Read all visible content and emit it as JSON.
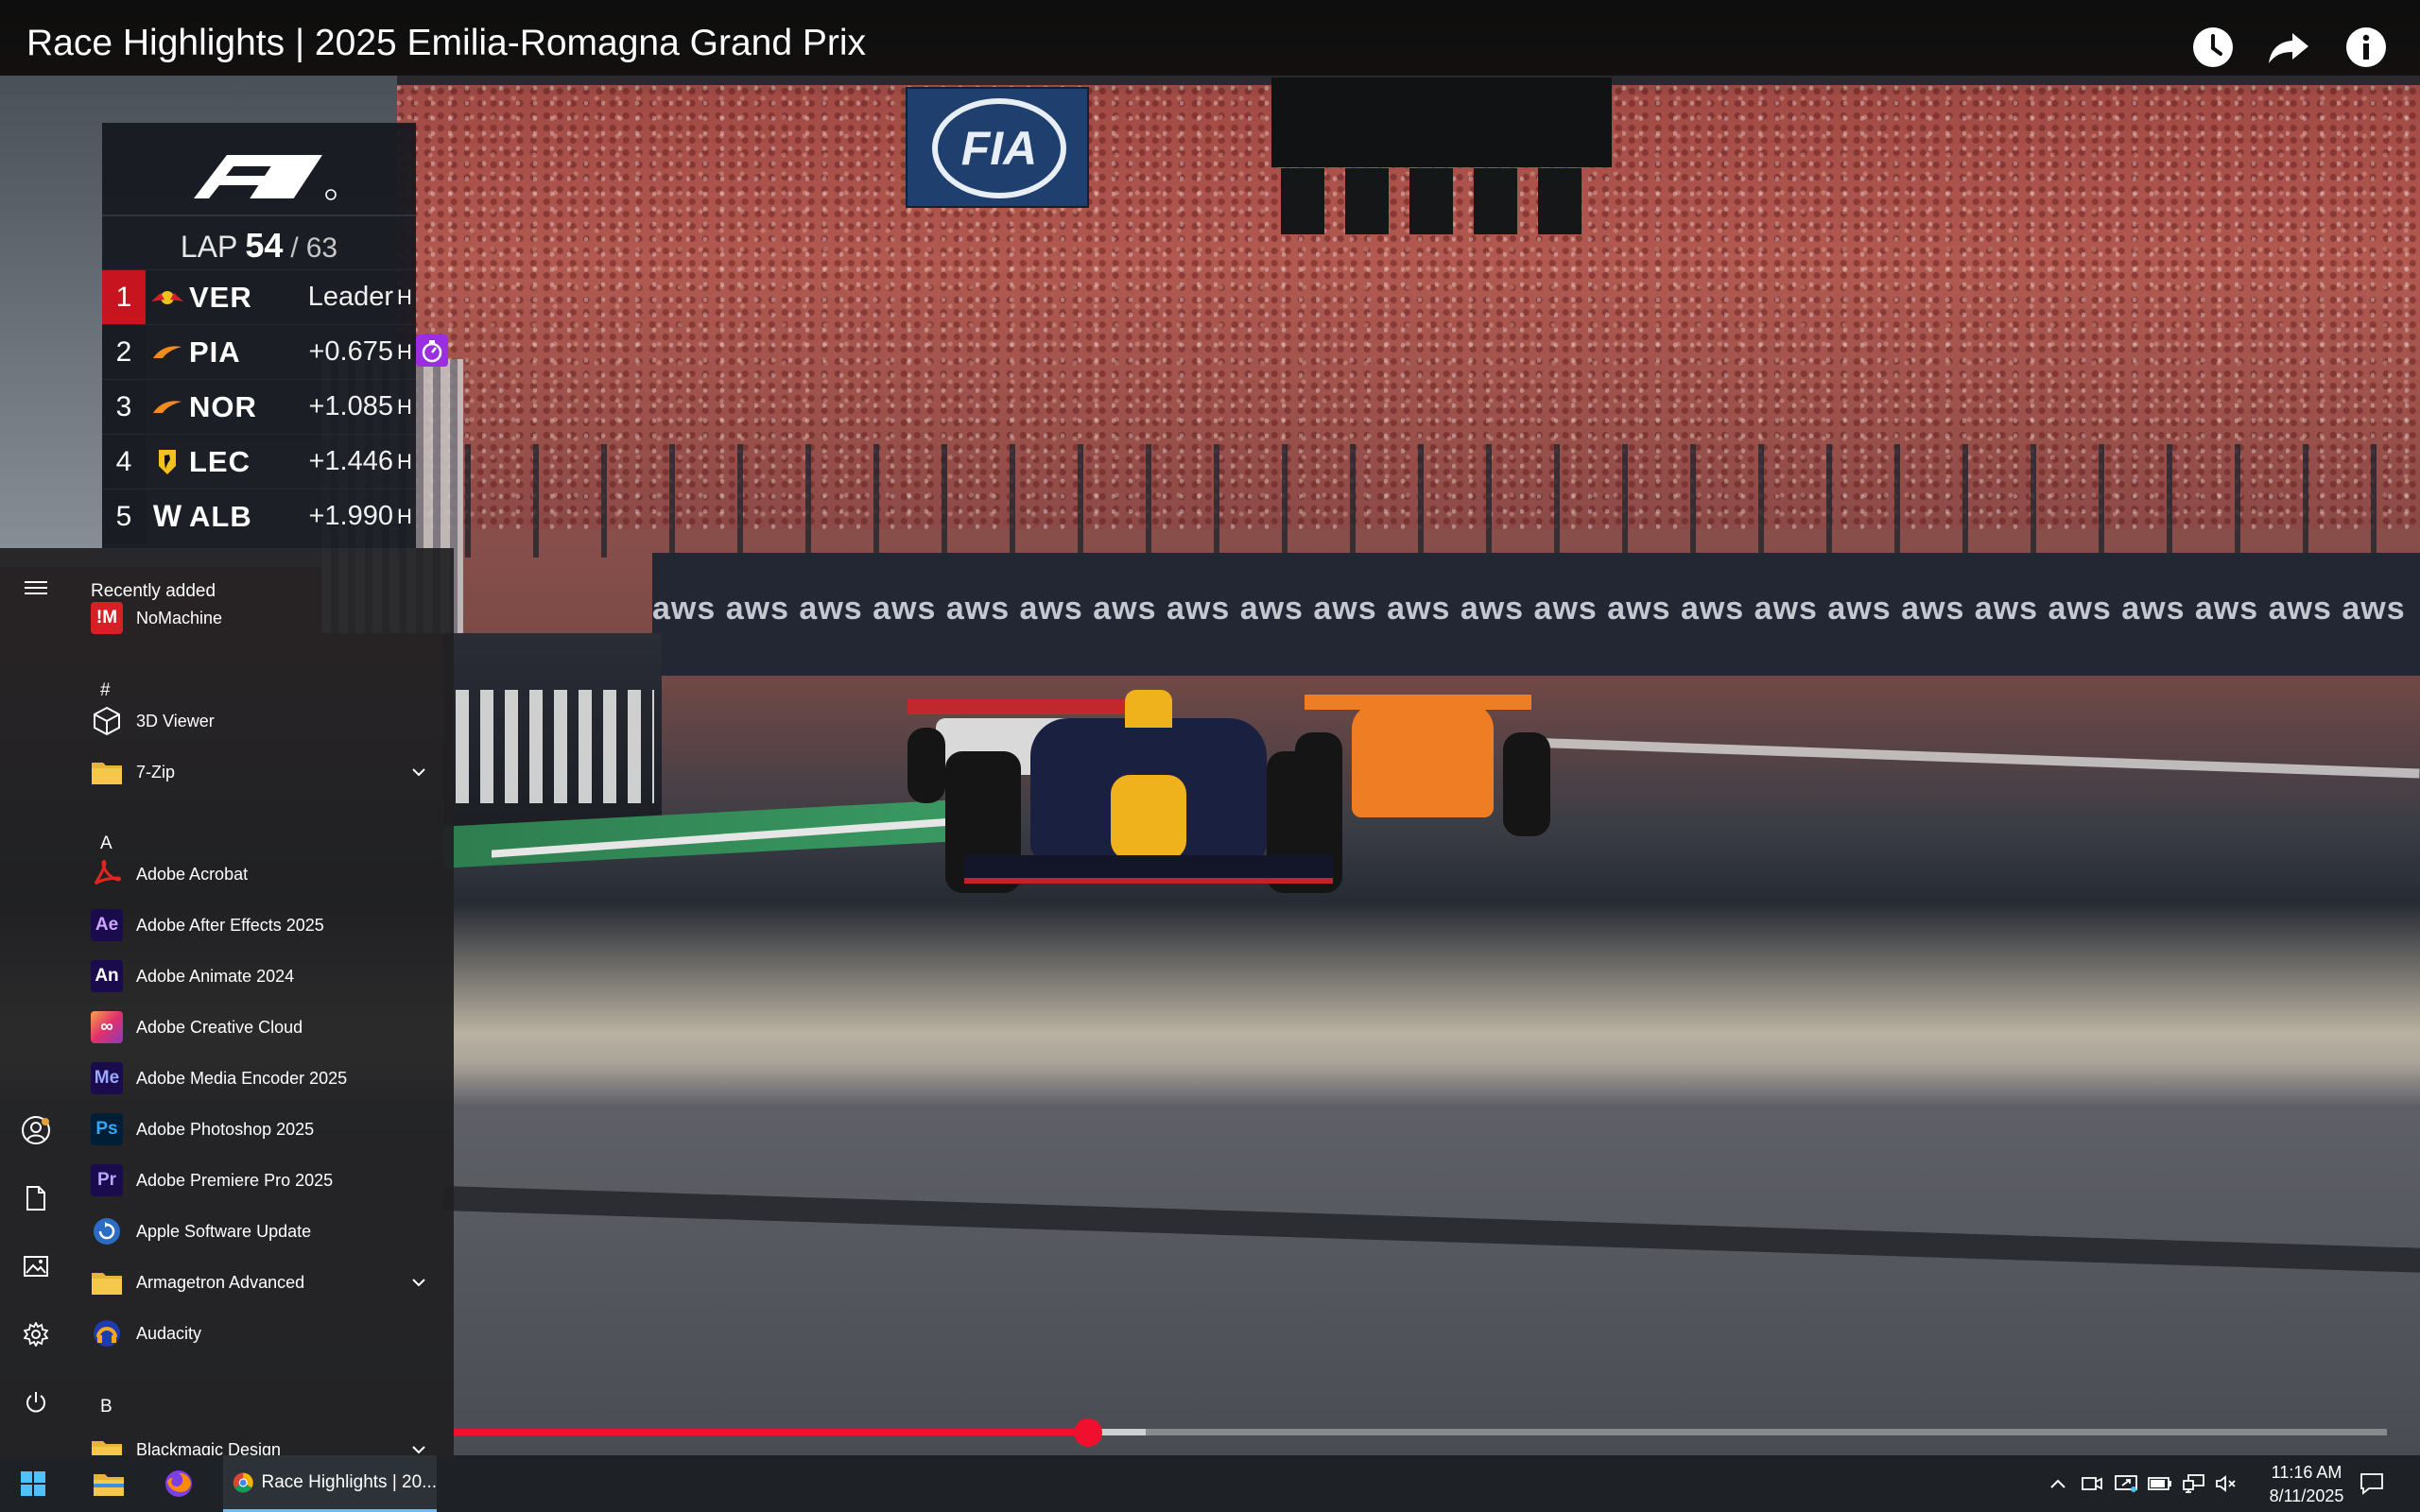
{
  "window": {
    "title": "Race Highlights | 2025 Emilia-Romagna Grand Prix"
  },
  "video_controls": {
    "clock_icon": "clock-icon",
    "share_icon": "share-arrow-icon",
    "info_icon": "info-icon",
    "progress_fraction": 0.328,
    "buffered_fraction": 0.358,
    "accent_color": "#f0102e"
  },
  "tower": {
    "lap_label": "LAP",
    "lap_current": "54",
    "lap_separator": "/",
    "lap_total": "63",
    "rows": [
      {
        "pos": "1",
        "team": "red-bull-icon",
        "code": "VER",
        "gap": "Leader",
        "tyre": "H"
      },
      {
        "pos": "2",
        "team": "mclaren-icon",
        "code": "PIA",
        "gap": "+0.675",
        "tyre": "H"
      },
      {
        "pos": "3",
        "team": "mclaren-icon",
        "code": "NOR",
        "gap": "+1.085",
        "tyre": "H"
      },
      {
        "pos": "4",
        "team": "ferrari-icon",
        "code": "LEC",
        "gap": "+1.446",
        "tyre": "H"
      },
      {
        "pos": "5",
        "team": "williams-icon",
        "code": "ALB",
        "gap": "+1.990",
        "tyre": "H"
      }
    ],
    "team_glyphs": {
      "williams": "W"
    },
    "lead_color": "#c8141e",
    "fastest_lap_color": "#9b2ee0"
  },
  "scene": {
    "fia_text": "FIA",
    "aws_text": "aws   aws   aws   aws   aws   aws   aws   aws   aws   aws   aws   aws   aws   aws   aws   aws   aws   aws   aws   aws   aws   aws   aws   aws"
  },
  "start_menu": {
    "header": "Recently added",
    "letters": {
      "hash": "#",
      "a": "A",
      "b": "B"
    },
    "apps": [
      {
        "name": "NoMachine",
        "icon": "nomachine-icon",
        "glyph": "!M",
        "color": "#d71f26"
      },
      {
        "name": "3D Viewer",
        "icon": "cube-icon",
        "glyph": "",
        "color": ""
      },
      {
        "name": "7-Zip",
        "icon": "folder-icon",
        "glyph": "",
        "color": "#e8b33a"
      },
      {
        "name": "Adobe Acrobat",
        "icon": "acrobat-icon",
        "glyph": "A",
        "color": "#b30b00"
      },
      {
        "name": "Adobe After Effects 2025",
        "icon": "after-effects-icon",
        "glyph": "Ae",
        "color": "#1a0b4d"
      },
      {
        "name": "Adobe Animate 2024",
        "icon": "animate-icon",
        "glyph": "An",
        "color": "#1a0b4d"
      },
      {
        "name": "Adobe Creative Cloud",
        "icon": "creative-cloud-icon",
        "glyph": "∞",
        "color": "#e1306c"
      },
      {
        "name": "Adobe Media Encoder 2025",
        "icon": "media-encoder-icon",
        "glyph": "Me",
        "color": "#1a0b4d"
      },
      {
        "name": "Adobe Photoshop 2025",
        "icon": "photoshop-icon",
        "glyph": "Ps",
        "color": "#001e36"
      },
      {
        "name": "Adobe Premiere Pro 2025",
        "icon": "premiere-icon",
        "glyph": "Pr",
        "color": "#1a0b4d"
      },
      {
        "name": "Apple Software Update",
        "icon": "apple-update-icon",
        "glyph": "",
        "color": "#2b6cc4"
      },
      {
        "name": "Armagetron Advanced",
        "icon": "folder-icon",
        "glyph": "",
        "color": "#e8b33a"
      },
      {
        "name": "Audacity",
        "icon": "audacity-icon",
        "glyph": "",
        "color": "#1e3bb0"
      },
      {
        "name": "Blackmagic Design",
        "icon": "folder-icon",
        "glyph": "",
        "color": "#e8b33a"
      }
    ]
  },
  "taskbar": {
    "chrome_label": "Race Highlights | 20...",
    "time": "11:16 AM",
    "date": "8/11/2025"
  }
}
